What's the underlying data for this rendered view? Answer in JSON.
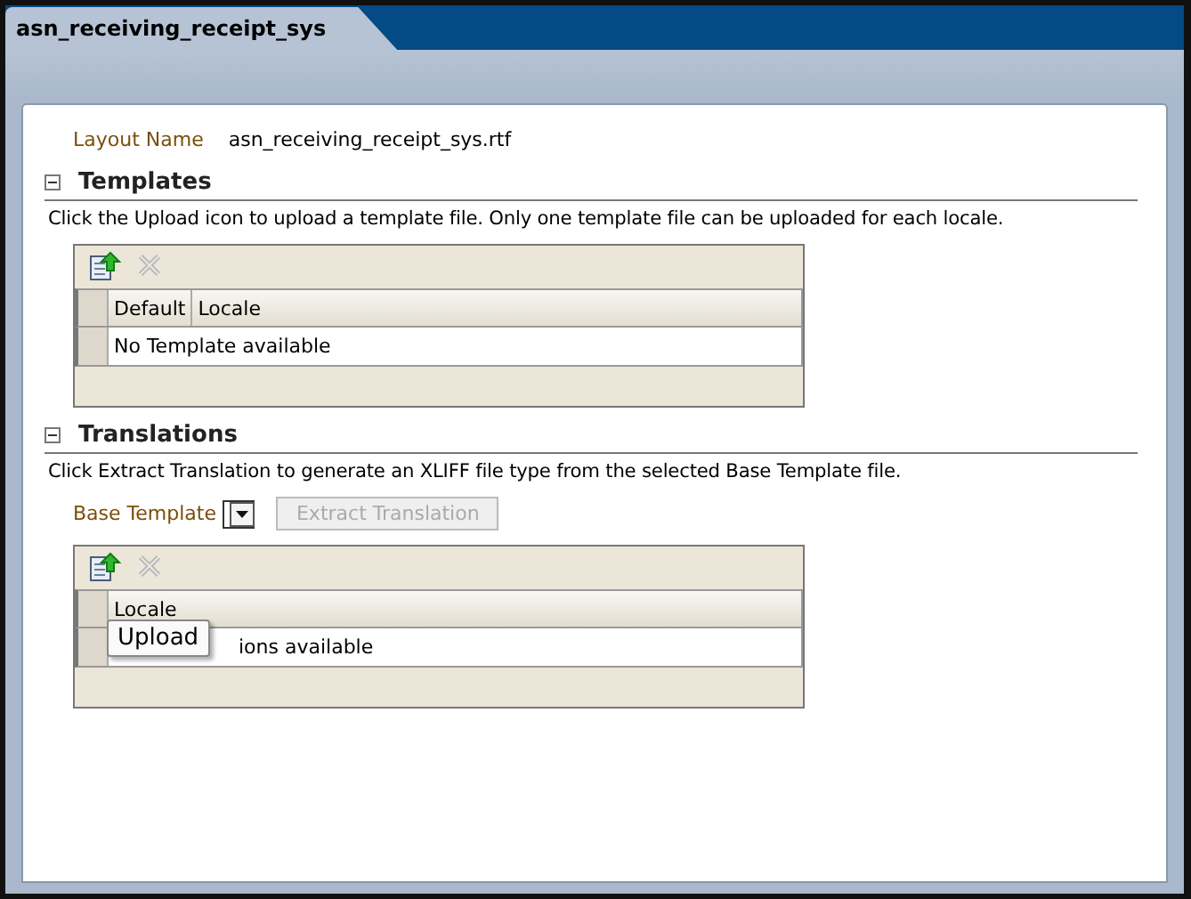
{
  "tab": {
    "title": "asn_receiving_receipt_sys"
  },
  "layout_name": {
    "label": "Layout Name",
    "value": "asn_receiving_receipt_sys.rtf"
  },
  "sections": [
    {
      "title": "Templates",
      "expanded": true,
      "description": "Click the Upload icon to upload a template file. Only one template file can be uploaded for each locale.",
      "table": {
        "columns": [
          "Default",
          "Locale"
        ],
        "empty_text": "No Template available"
      }
    },
    {
      "title": "Translations",
      "expanded": true,
      "description": "Click Extract Translation to generate an XLIFF file type from the selected Base Template file.",
      "base_template": {
        "label": "Base Template",
        "button": {
          "label": "Extract Translation",
          "disabled": true
        }
      },
      "table": {
        "columns": [
          "Locale"
        ],
        "empty_text": "ions available"
      },
      "tooltip": {
        "text": "Upload"
      }
    }
  ]
}
